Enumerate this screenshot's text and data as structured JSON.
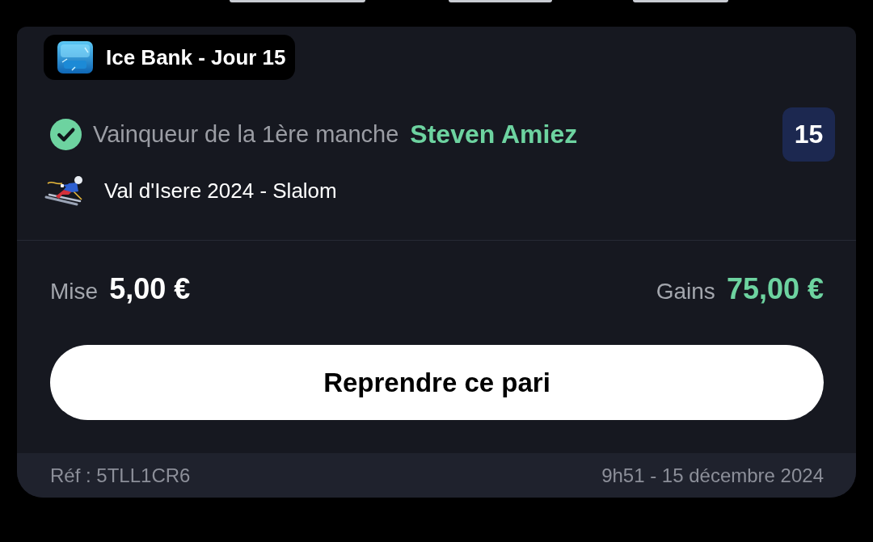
{
  "bet": {
    "competition": {
      "title": "Ice Bank - Jour 15"
    },
    "selection": {
      "won": true,
      "market": "Vainqueur de la 1ère manche",
      "pick": "Steven Amiez",
      "badge": "15"
    },
    "event": {
      "name": "Val d'Isere 2024 - Slalom"
    },
    "stake": {
      "label": "Mise",
      "value": "5,00 €"
    },
    "winnings": {
      "label": "Gains",
      "value": "75,00 €"
    },
    "action_button": "Reprendre ce pari",
    "footer": {
      "reference": "Réf : 5TLL1CR6",
      "date": "9h51 - 15 décembre 2024"
    }
  }
}
